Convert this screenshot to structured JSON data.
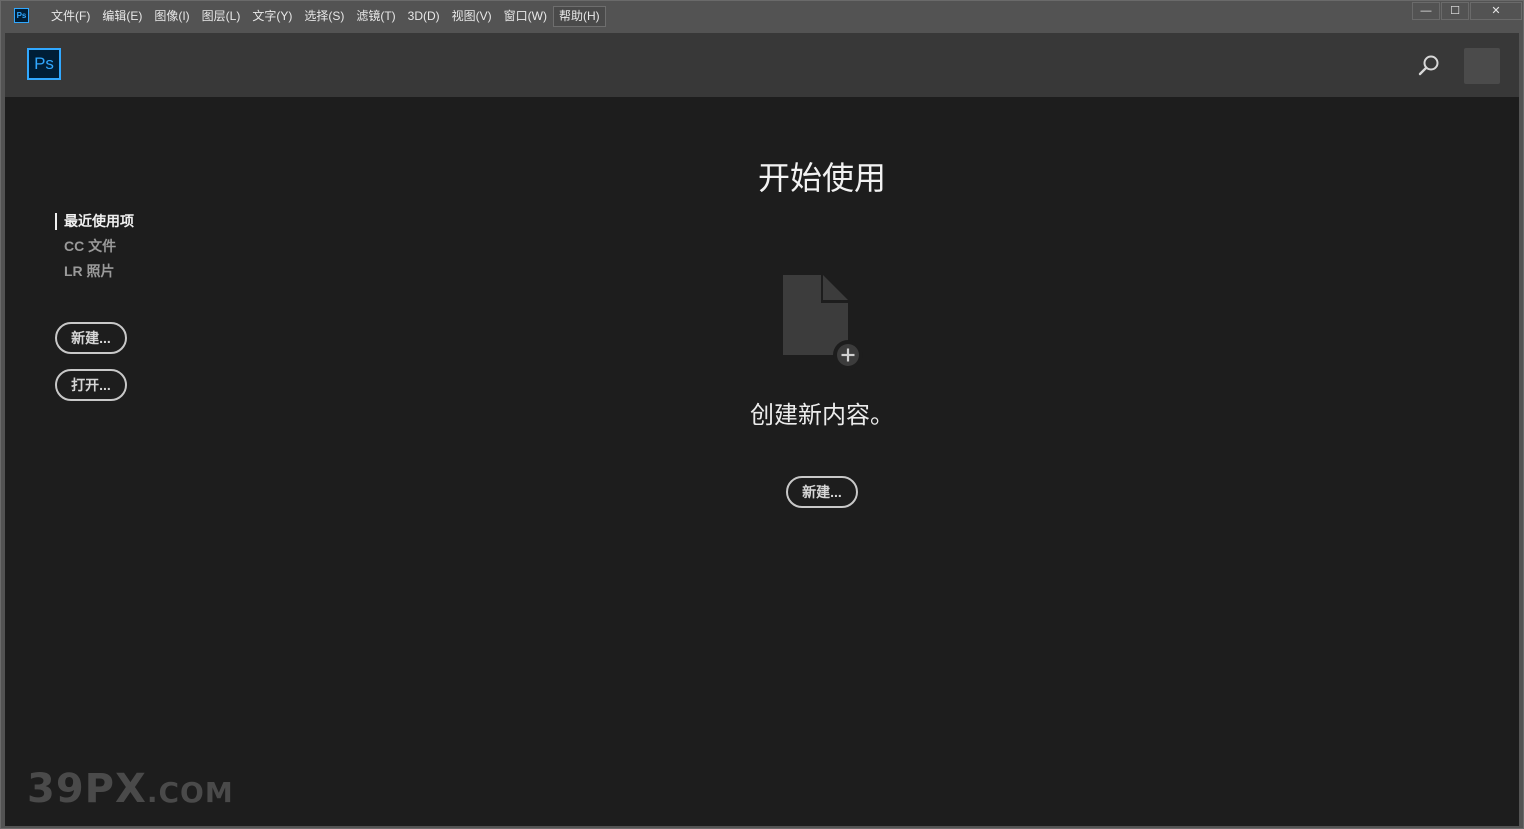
{
  "menubar": {
    "app_icon": "Ps",
    "items": [
      "文件(F)",
      "编辑(E)",
      "图像(I)",
      "图层(L)",
      "文字(Y)",
      "选择(S)",
      "滤镜(T)",
      "3D(D)",
      "视图(V)",
      "窗口(W)",
      "帮助(H)"
    ],
    "window_controls": {
      "minimize": "—",
      "maximize": "☐",
      "close": "✕"
    }
  },
  "header": {
    "logo": "Ps",
    "search_icon": "search-icon"
  },
  "sidebar": {
    "items": [
      {
        "label": "最近使用项",
        "active": true
      },
      {
        "label": "CC 文件",
        "active": false
      },
      {
        "label": "LR 照片",
        "active": false
      }
    ],
    "new_button": "新建...",
    "open_button": "打开..."
  },
  "main": {
    "title": "开始使用",
    "create_text": "创建新内容。",
    "new_button": "新建...",
    "doc_icon": "new-document-icon"
  },
  "watermark": {
    "main": "39PX",
    "suffix": ".COM"
  },
  "colors": {
    "accent": "#31a8ff",
    "background": "#1d1d1d",
    "header": "#383838",
    "menubar": "#535353"
  }
}
